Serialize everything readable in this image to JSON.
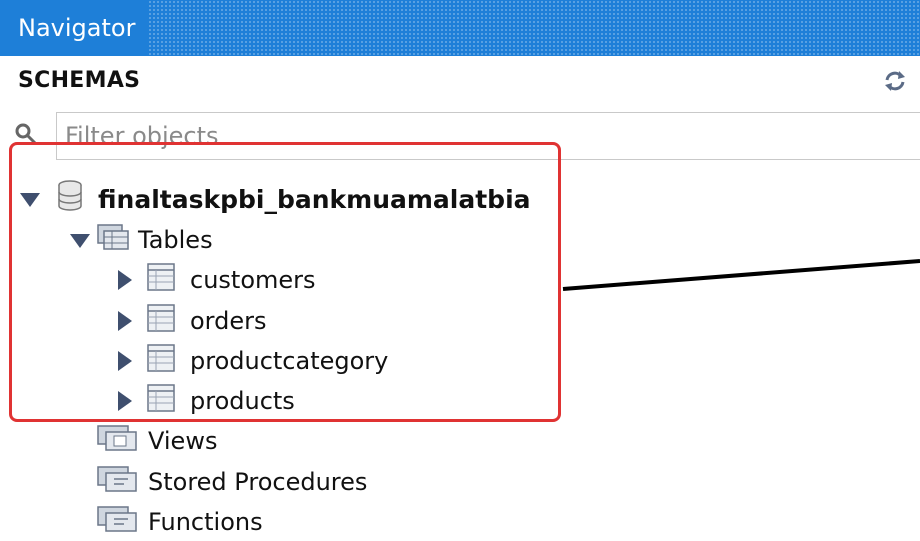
{
  "panel": {
    "title": "Navigator"
  },
  "schemas": {
    "label": "SCHEMAS",
    "filter_placeholder": "Filter objects"
  },
  "tree": {
    "schema": "finaltaskpbi_bankmuamalatbia",
    "tables_label": "Tables",
    "tables": [
      "customers",
      "orders",
      "productcategory",
      "products"
    ],
    "views_label": "Views",
    "procedures_label": "Stored Procedures",
    "functions_label": "Functions"
  },
  "colors": {
    "titlebar": "#1e7fd8",
    "highlight_border": "#e03333",
    "tree_arrow": "#3f4f6e"
  }
}
